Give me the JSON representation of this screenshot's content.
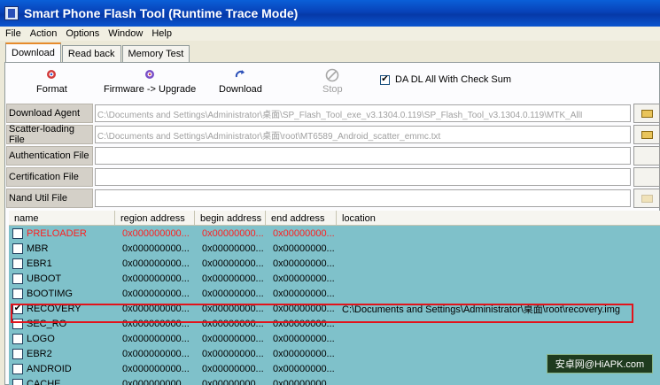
{
  "window": {
    "title": "Smart Phone Flash Tool (Runtime Trace Mode)"
  },
  "menu": [
    "File",
    "Action",
    "Options",
    "Window",
    "Help"
  ],
  "tabs": [
    {
      "label": "Download",
      "active": true
    },
    {
      "label": "Read back",
      "active": false
    },
    {
      "label": "Memory Test",
      "active": false
    }
  ],
  "toolbar": {
    "format": "Format",
    "firmware_upgrade": "Firmware -> Upgrade",
    "download": "Download",
    "stop": "Stop",
    "checksum_label": "DA DL All With Check Sum",
    "checksum_checked": true
  },
  "fields": [
    {
      "label": "Download Agent",
      "value": "C:\\Documents and Settings\\Administrator\\桌面\\SP_Flash_Tool_exe_v3.1304.0.119\\SP_Flash_Tool_v3.1304.0.119\\MTK_AllI"
    },
    {
      "label": "Scatter-loading File",
      "value": "C:\\Documents and Settings\\Administrator\\桌面\\root\\MT6589_Android_scatter_emmc.txt"
    },
    {
      "label": "Authentication File",
      "value": ""
    },
    {
      "label": "Certification File",
      "value": ""
    },
    {
      "label": "Nand Util File",
      "value": ""
    }
  ],
  "table": {
    "headers": [
      "name",
      "region address",
      "begin address",
      "end address",
      "location"
    ],
    "rows": [
      {
        "name": "PRELOADER",
        "region": "0x000000000...",
        "begin": "0x00000000...",
        "end": "0x00000000...",
        "location": "",
        "checked": false,
        "red": true
      },
      {
        "name": "MBR",
        "region": "0x000000000...",
        "begin": "0x00000000...",
        "end": "0x00000000...",
        "location": "",
        "checked": false,
        "red": false
      },
      {
        "name": "EBR1",
        "region": "0x000000000...",
        "begin": "0x00000000...",
        "end": "0x00000000...",
        "location": "",
        "checked": false,
        "red": false
      },
      {
        "name": "UBOOT",
        "region": "0x000000000...",
        "begin": "0x00000000...",
        "end": "0x00000000...",
        "location": "",
        "checked": false,
        "red": false
      },
      {
        "name": "BOOTIMG",
        "region": "0x000000000...",
        "begin": "0x00000000...",
        "end": "0x00000000...",
        "location": "",
        "checked": false,
        "red": false
      },
      {
        "name": "RECOVERY",
        "region": "0x000000000...",
        "begin": "0x00000000...",
        "end": "0x00000000...",
        "location": "C:\\Documents and Settings\\Administrator\\桌面\\root\\recovery.img",
        "checked": true,
        "red": false
      },
      {
        "name": "SEC_RO",
        "region": "0x000000000...",
        "begin": "0x00000000...",
        "end": "0x00000000...",
        "location": "",
        "checked": false,
        "red": false
      },
      {
        "name": "LOGO",
        "region": "0x000000000...",
        "begin": "0x00000000...",
        "end": "0x00000000...",
        "location": "",
        "checked": false,
        "red": false
      },
      {
        "name": "EBR2",
        "region": "0x000000000...",
        "begin": "0x00000000...",
        "end": "0x00000000...",
        "location": "",
        "checked": false,
        "red": false
      },
      {
        "name": "ANDROID",
        "region": "0x000000000...",
        "begin": "0x00000000...",
        "end": "0x00000000...",
        "location": "",
        "checked": false,
        "red": false
      },
      {
        "name": "CACHE",
        "region": "0x000000000...",
        "begin": "0x00000000...",
        "end": "0x00000000...",
        "location": "",
        "checked": false,
        "red": false
      }
    ]
  },
  "watermark": "安卓网@HiAPK.com",
  "colors": {
    "title_bar": "#0842b8",
    "table_bg": "#7fc1ca",
    "highlight": "#e2131b",
    "red_text": "#ff1e1e"
  }
}
